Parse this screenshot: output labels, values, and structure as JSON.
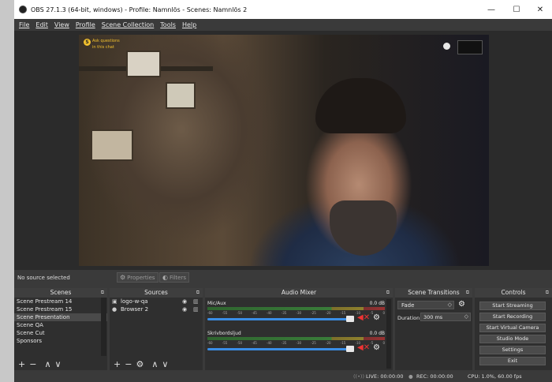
{
  "window": {
    "title": "OBS 27.1.3 (64-bit, windows) - Profile: Namnlös - Scenes: Namnlös 2",
    "minimize": "—",
    "maximize": "☐",
    "close": "✕"
  },
  "menu": [
    "File",
    "Edit",
    "View",
    "Profile",
    "Scene Collection",
    "Tools",
    "Help"
  ],
  "preview": {
    "chat_badge": "S",
    "chat_line1": "Ask questions",
    "chat_line2": "in this chat"
  },
  "source_bar": {
    "no_source": "No source selected",
    "properties": "Properties",
    "filters": "Filters"
  },
  "scenes": {
    "title": "Scenes",
    "items": [
      "Scene Prestream 14",
      "Scene Prestream 15",
      "Scene Presentation",
      "Scene QA",
      "Scene Cut",
      "Sponsors"
    ],
    "selected_index": 2,
    "footer": [
      "+",
      "−",
      "∧",
      "∨"
    ]
  },
  "sources": {
    "title": "Sources",
    "items": [
      "logo-w-qa",
      "Browser 2"
    ],
    "footer": [
      "+",
      "−",
      "⚙",
      "∧",
      "∨"
    ]
  },
  "mixer": {
    "title": "Audio Mixer",
    "channels": [
      {
        "name": "Mic/Aux",
        "db": "0.0 dB",
        "volume": 0.95
      },
      {
        "name": "Skrivbordsljud",
        "db": "0.0 dB",
        "volume": 0.95
      }
    ],
    "ticks": [
      "-60",
      "-55",
      "-50",
      "-45",
      "-40",
      "-35",
      "-30",
      "-25",
      "-20",
      "-15",
      "-10",
      "-5",
      "0"
    ]
  },
  "transitions": {
    "title": "Scene Transitions",
    "selected": "Fade",
    "duration_label": "Duration",
    "duration_value": "300 ms"
  },
  "controls": {
    "title": "Controls",
    "buttons": [
      "Start Streaming",
      "Start Recording",
      "Start Virtual Camera",
      "Studio Mode",
      "Settings",
      "Exit"
    ]
  },
  "status": {
    "live": "LIVE: 00:00:00",
    "rec": "REC: 00:00:00",
    "cpu": "CPU: 1.0%, 60.00 fps"
  },
  "colors": {
    "accent": "#3a8ee6",
    "mute": "#e33333",
    "window_bg": "#3a3a3a"
  }
}
